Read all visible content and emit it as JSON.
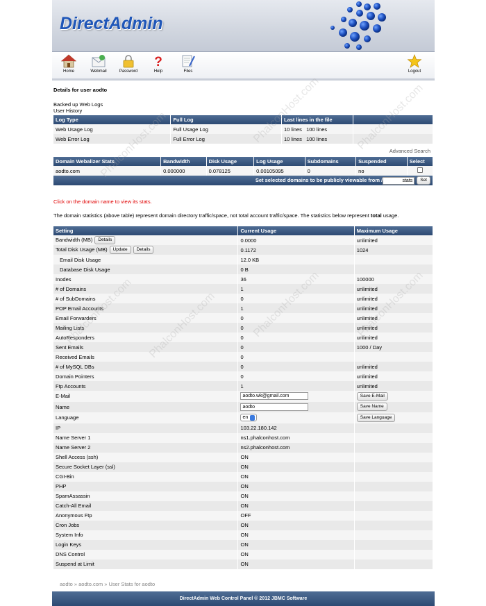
{
  "header": {
    "logo_text": "DirectAdmin"
  },
  "toolbar": [
    {
      "name": "home",
      "label": "Home",
      "icon": "house-icon"
    },
    {
      "name": "webmail",
      "label": "Webmail",
      "icon": "webmail-icon"
    },
    {
      "name": "password",
      "label": "Password",
      "icon": "padlock-icon"
    },
    {
      "name": "help",
      "label": "Help",
      "icon": "question-mark-icon"
    },
    {
      "name": "files",
      "label": "Files",
      "icon": "files-icon"
    },
    {
      "name": "logout",
      "label": "Logout",
      "icon": "star-icon"
    }
  ],
  "page_title": "Details for user aodto",
  "links": {
    "backed_up": "Backed up Web Logs",
    "history": "User History"
  },
  "log_table": {
    "headers": [
      "Log Type",
      "Full Log",
      "Last lines in the file"
    ],
    "rows": [
      {
        "type": "Web Usage Log",
        "full": "Full Usage Log",
        "lines_a": "10 lines",
        "lines_b": "100 lines"
      },
      {
        "type": "Web Error Log",
        "full": "Full Error Log",
        "lines_a": "10 lines",
        "lines_b": "100 lines"
      }
    ]
  },
  "advanced_search": "Advanced Search",
  "domain_table": {
    "headers": [
      "Domain Webalizer Stats",
      "Bandwidth",
      "Disk Usage",
      "Log Usage",
      "Subdomains",
      "Suspended",
      "Select"
    ],
    "row": {
      "domain": "aodto.com",
      "bandwidth": "0.000000",
      "disk": "0.078125",
      "log": "0.00105095",
      "subdomains": "0",
      "suspended": "no"
    },
    "action_text": "Set selected domains to be publicly viewable from /",
    "action_input": "stats",
    "action_button": "Set"
  },
  "click_notice": "Click on the domain name to view its stats.",
  "stats_note_before": "The domain statistics (above table) represent domain directory traffic/space, not total account traffic/space. The statistics below represent ",
  "stats_note_bold": "total",
  "stats_note_after": " usage.",
  "stats_table": {
    "headers": [
      "Setting",
      "Current Usage",
      "Maximum Usage"
    ],
    "rows": [
      {
        "s": "Bandwidth (MB)",
        "c": "0.0000",
        "m": "unlimited",
        "btns": [
          "Details"
        ]
      },
      {
        "s": "Total Disk Usage (MB)",
        "c": "0.1172",
        "m": "1024",
        "btns": [
          "Update",
          "Details"
        ]
      },
      {
        "s": "Email Disk Usage",
        "c": "12.0 KB",
        "m": "",
        "indent": true
      },
      {
        "s": "Database Disk Usage",
        "c": "0 B",
        "m": "",
        "indent": true
      },
      {
        "s": "Inodes",
        "c": "36",
        "m": "100000"
      },
      {
        "s": "# of Domains",
        "c": "1",
        "m": "unlimited"
      },
      {
        "s": "# of SubDomains",
        "c": "0",
        "m": "unlimited"
      },
      {
        "s": "POP Email Accounts",
        "c": "1",
        "m": "unlimited"
      },
      {
        "s": "Email Forwarders",
        "c": "0",
        "m": "unlimited"
      },
      {
        "s": "Mailing Lists",
        "c": "0",
        "m": "unlimited"
      },
      {
        "s": "AutoResponders",
        "c": "0",
        "m": "unlimited"
      },
      {
        "s": "Sent Emails",
        "c": "0",
        "m": "1000 / Day"
      },
      {
        "s": "Received Emails",
        "c": "0",
        "m": ""
      },
      {
        "s": "# of MySQL DBs",
        "c": "0",
        "m": "unlimited"
      },
      {
        "s": "Domain Pointers",
        "c": "0",
        "m": "unlimited"
      },
      {
        "s": "Ftp Accounts",
        "c": "1",
        "m": "unlimited"
      },
      {
        "s": "E-Mail",
        "input": "aodto.wk@gmail.com",
        "mbtn": "Save E-Mail"
      },
      {
        "s": "Name",
        "input": "aodto",
        "mbtn": "Save Name"
      },
      {
        "s": "Language",
        "select": "en",
        "mbtn": "Save Language"
      },
      {
        "s": "IP",
        "c": "103.22.180.142",
        "m": ""
      },
      {
        "s": "Name Server 1",
        "c": "ns1.phalconhost.com",
        "m": ""
      },
      {
        "s": "Name Server 2",
        "c": "ns2.phalconhost.com",
        "m": ""
      },
      {
        "s": "Shell Access (ssh)",
        "c": "ON",
        "m": ""
      },
      {
        "s": "Secure Socket Layer (ssl)",
        "c": "ON",
        "m": ""
      },
      {
        "s": "CGI-Bin",
        "c": "ON",
        "m": ""
      },
      {
        "s": "PHP",
        "c": "ON",
        "m": ""
      },
      {
        "s": "SpamAssassin",
        "c": "ON",
        "m": ""
      },
      {
        "s": "Catch-All Email",
        "c": "ON",
        "m": ""
      },
      {
        "s": "Anonymous Ftp",
        "c": "OFF",
        "m": ""
      },
      {
        "s": "Cron Jobs",
        "c": "ON",
        "m": ""
      },
      {
        "s": "System Info",
        "c": "ON",
        "m": ""
      },
      {
        "s": "Login Keys",
        "c": "ON",
        "m": ""
      },
      {
        "s": "DNS Control",
        "c": "ON",
        "m": ""
      },
      {
        "s": "Suspend at Limit",
        "c": "ON",
        "m": ""
      }
    ]
  },
  "breadcrumb": {
    "a": "aodto",
    "b": "aodto.com",
    "current": "User Stats for aodto",
    "sep": " » "
  },
  "footer": "DirectAdmin Web Control Panel © 2012 JBMC Software",
  "watermark": "PhalconHost.com"
}
